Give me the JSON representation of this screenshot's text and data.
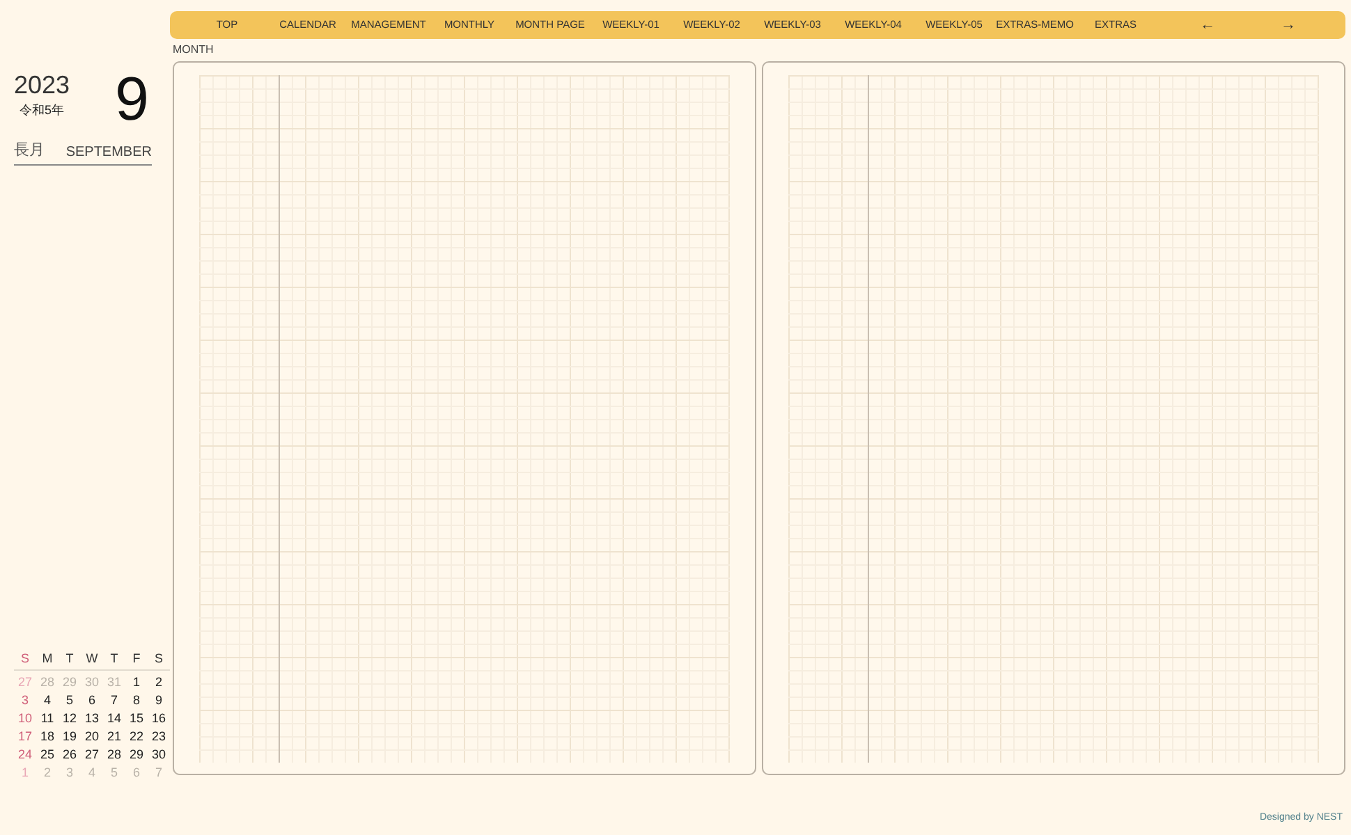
{
  "nav": {
    "items": [
      {
        "label": "TOP"
      },
      {
        "label": "CALENDAR"
      },
      {
        "label": "MANAGEMENT"
      },
      {
        "label": "MONTHLY"
      },
      {
        "label": "MONTH PAGE"
      },
      {
        "label": "WEEKLY-01"
      },
      {
        "label": "WEEKLY-02"
      },
      {
        "label": "WEEKLY-03"
      },
      {
        "label": "WEEKLY-04"
      },
      {
        "label": "WEEKLY-05"
      },
      {
        "label": "EXTRAS-MEMO"
      },
      {
        "label": "EXTRAS"
      }
    ],
    "prev": "←",
    "next": "→"
  },
  "header": {
    "year": "2023",
    "era": "令和5年",
    "month_number": "9",
    "month_jp": "長月",
    "month_en": "SEPTEMBER"
  },
  "section_label": "MONTH",
  "mini_calendar": {
    "weekdays": [
      "S",
      "M",
      "T",
      "W",
      "T",
      "F",
      "S"
    ],
    "weeks": [
      [
        {
          "day": "27",
          "muted": true
        },
        {
          "day": "28",
          "muted": true
        },
        {
          "day": "29",
          "muted": true
        },
        {
          "day": "30",
          "muted": true
        },
        {
          "day": "31",
          "muted": true
        },
        {
          "day": "1",
          "muted": false
        },
        {
          "day": "2",
          "muted": false
        }
      ],
      [
        {
          "day": "3",
          "muted": false
        },
        {
          "day": "4",
          "muted": false
        },
        {
          "day": "5",
          "muted": false
        },
        {
          "day": "6",
          "muted": false
        },
        {
          "day": "7",
          "muted": false
        },
        {
          "day": "8",
          "muted": false
        },
        {
          "day": "9",
          "muted": false
        }
      ],
      [
        {
          "day": "10",
          "muted": false
        },
        {
          "day": "11",
          "muted": false
        },
        {
          "day": "12",
          "muted": false
        },
        {
          "day": "13",
          "muted": false
        },
        {
          "day": "14",
          "muted": false
        },
        {
          "day": "15",
          "muted": false
        },
        {
          "day": "16",
          "muted": false
        }
      ],
      [
        {
          "day": "17",
          "muted": false
        },
        {
          "day": "18",
          "muted": false
        },
        {
          "day": "19",
          "muted": false
        },
        {
          "day": "20",
          "muted": false
        },
        {
          "day": "21",
          "muted": false
        },
        {
          "day": "22",
          "muted": false
        },
        {
          "day": "23",
          "muted": false
        }
      ],
      [
        {
          "day": "24",
          "muted": false
        },
        {
          "day": "25",
          "muted": false
        },
        {
          "day": "26",
          "muted": false
        },
        {
          "day": "27",
          "muted": false
        },
        {
          "day": "28",
          "muted": false
        },
        {
          "day": "29",
          "muted": false
        },
        {
          "day": "30",
          "muted": false
        }
      ],
      [
        {
          "day": "1",
          "muted": true
        },
        {
          "day": "2",
          "muted": true
        },
        {
          "day": "3",
          "muted": true
        },
        {
          "day": "4",
          "muted": true
        },
        {
          "day": "5",
          "muted": true
        },
        {
          "day": "6",
          "muted": true
        },
        {
          "day": "7",
          "muted": true
        }
      ]
    ]
  },
  "footer": "Designed by NEST"
}
